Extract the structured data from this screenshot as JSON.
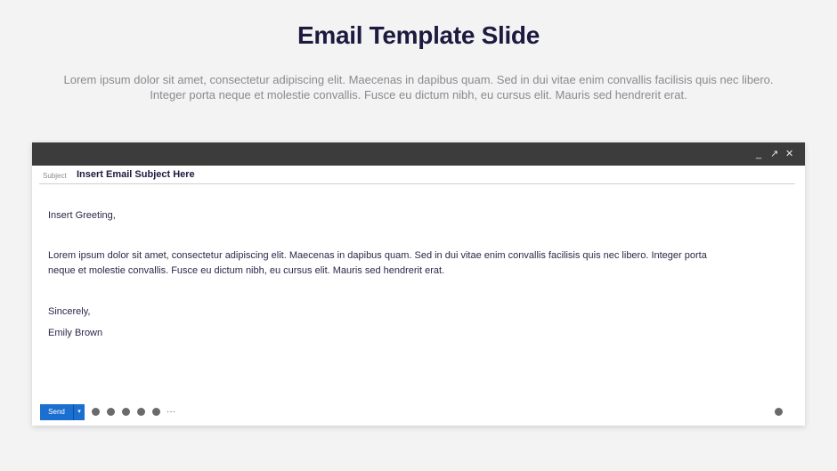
{
  "slide": {
    "title": "Email Template Slide",
    "subtitle": "Lorem ipsum dolor sit amet, consectetur adipiscing elit. Maecenas in dapibus quam. Sed in dui vitae enim convallis facilisis quis nec libero. Integer porta neque et molestie convallis. Fusce eu dictum nibh, eu cursus elit. Mauris sed hendrerit erat."
  },
  "window": {
    "controls": {
      "minimize": "_",
      "expand": "↗",
      "close": "✕"
    }
  },
  "email": {
    "subject_label": "Subject",
    "subject_value": "Insert Email Subject Here",
    "greeting": "Insert Greeting,",
    "body": "Lorem ipsum dolor sit amet, consectetur adipiscing elit. Maecenas in dapibus quam. Sed in dui vitae enim convallis facilisis quis nec libero. Integer porta neque et molestie convallis. Fusce eu dictum nibh, eu cursus elit. Mauris sed hendrerit erat.",
    "closing": "Sincerely,",
    "signature": "Emily Brown"
  },
  "toolbar": {
    "send_label": "Send",
    "caret": "▾",
    "more": "···"
  },
  "colors": {
    "accent": "#1b6fd1",
    "titlebar": "#3c3c3c",
    "title_text": "#1d1a3f"
  }
}
